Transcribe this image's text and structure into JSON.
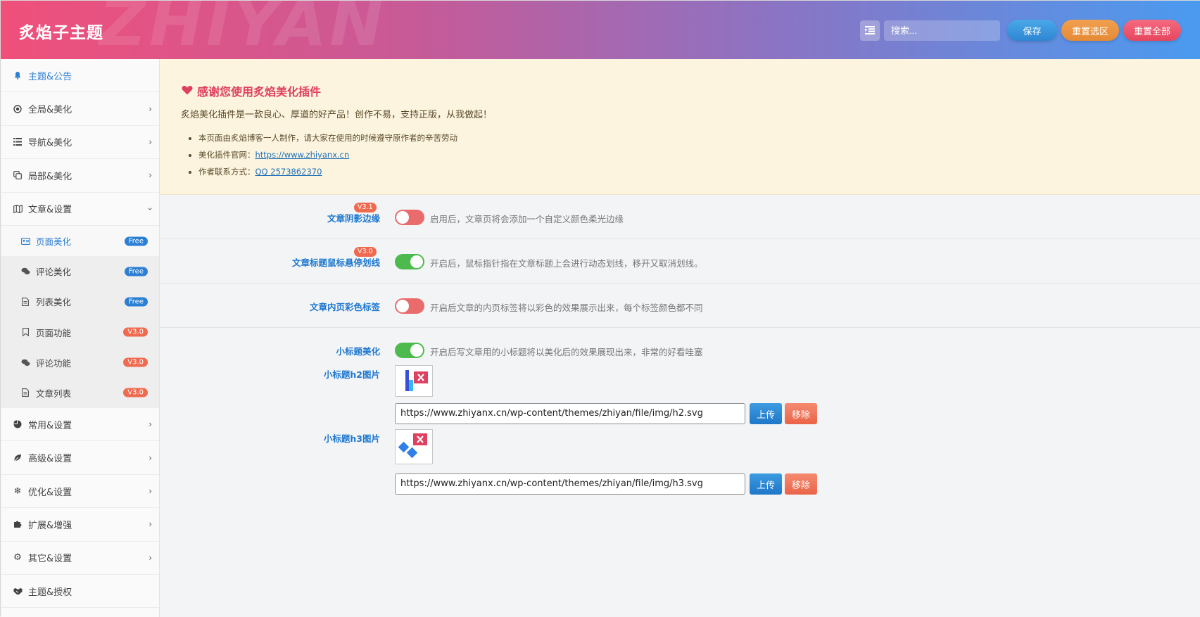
{
  "header": {
    "brand": "炙焰子主题",
    "watermark": "ZHIYAN",
    "search_placeholder": "搜索...",
    "save_label": "保存",
    "reset_section_label": "重置选区",
    "reset_all_label": "重置全部"
  },
  "sidebar": {
    "items": [
      {
        "label": "主题&公告",
        "icon": "bell-icon"
      },
      {
        "label": "全局&美化",
        "icon": "target-icon"
      },
      {
        "label": "导航&美化",
        "icon": "list-icon"
      },
      {
        "label": "局部&美化",
        "icon": "copy-icon"
      },
      {
        "label": "文章&设置",
        "icon": "map-icon"
      }
    ],
    "sub_items": [
      {
        "label": "页面美化",
        "badge": "Free",
        "icon": "id-card-icon"
      },
      {
        "label": "评论美化",
        "badge": "Free",
        "icon": "comments-icon"
      },
      {
        "label": "列表美化",
        "badge": "Free",
        "icon": "file-icon"
      },
      {
        "label": "页面功能",
        "badge": "V3.0",
        "icon": "bookmark-icon"
      },
      {
        "label": "评论功能",
        "badge": "V3.0",
        "icon": "comments-icon"
      },
      {
        "label": "文章列表",
        "badge": "V3.0",
        "icon": "file-icon"
      }
    ],
    "items_after": [
      {
        "label": "常用&设置",
        "icon": "pie-icon"
      },
      {
        "label": "高级&设置",
        "icon": "leaf-icon"
      },
      {
        "label": "优化&设置",
        "icon": "snowflake-icon"
      },
      {
        "label": "扩展&增强",
        "icon": "puzzle-icon"
      },
      {
        "label": "其它&设置",
        "icon": "gear-icon"
      },
      {
        "label": "主题&授权",
        "icon": "handshake-icon"
      }
    ]
  },
  "notice": {
    "title": "感谢您使用炙焰美化插件",
    "desc": "炙焰美化插件是一款良心、厚道的好产品！创作不易，支持正版，从我做起！",
    "line1": "本页面由炙焰博客一人制作，请大家在使用的时候遵守原作者的辛苦劳动",
    "line2_prefix": "美化插件官网：",
    "line2_link": "https://www.zhiyanx.cn",
    "line3_prefix": "作者联系方式：",
    "line3_link": "QQ 2573862370"
  },
  "settings": [
    {
      "label": "文章阴影边缘",
      "badge": "V3.1",
      "on": false,
      "desc": "启用后，文章页将会添加一个自定义颜色柔光边缘"
    },
    {
      "label": "文章标题鼠标悬停划线",
      "badge": "V3.0",
      "on": true,
      "desc": "开启后，鼠标指针指在文章标题上会进行动态划线，移开又取消划线。"
    },
    {
      "label": "文章内页彩色标签",
      "badge": "",
      "on": false,
      "desc": "开启后文章的内页标签将以彩色的效果展示出来，每个标签颜色都不同"
    },
    {
      "label": "小标题美化",
      "badge": "",
      "on": true,
      "desc": "开启后写文章用的小标题将以美化后的效果展现出来，非常的好看哇塞"
    }
  ],
  "images": {
    "h2_label": "小标题h2图片",
    "h2_url": "https://www.zhiyanx.cn/wp-content/themes/zhiyan/file/img/h2.svg",
    "h3_label": "小标题h3图片",
    "h3_url": "https://www.zhiyanx.cn/wp-content/themes/zhiyan/file/img/h3.svg",
    "upload_label": "上传",
    "remove_label": "移除"
  },
  "colors": {
    "accent": "#1e78d0",
    "toggle_on": "#4cba4c",
    "toggle_off": "#e96b6b",
    "badge_v3": "#f06a50",
    "badge_free": "#2b7fd4"
  }
}
